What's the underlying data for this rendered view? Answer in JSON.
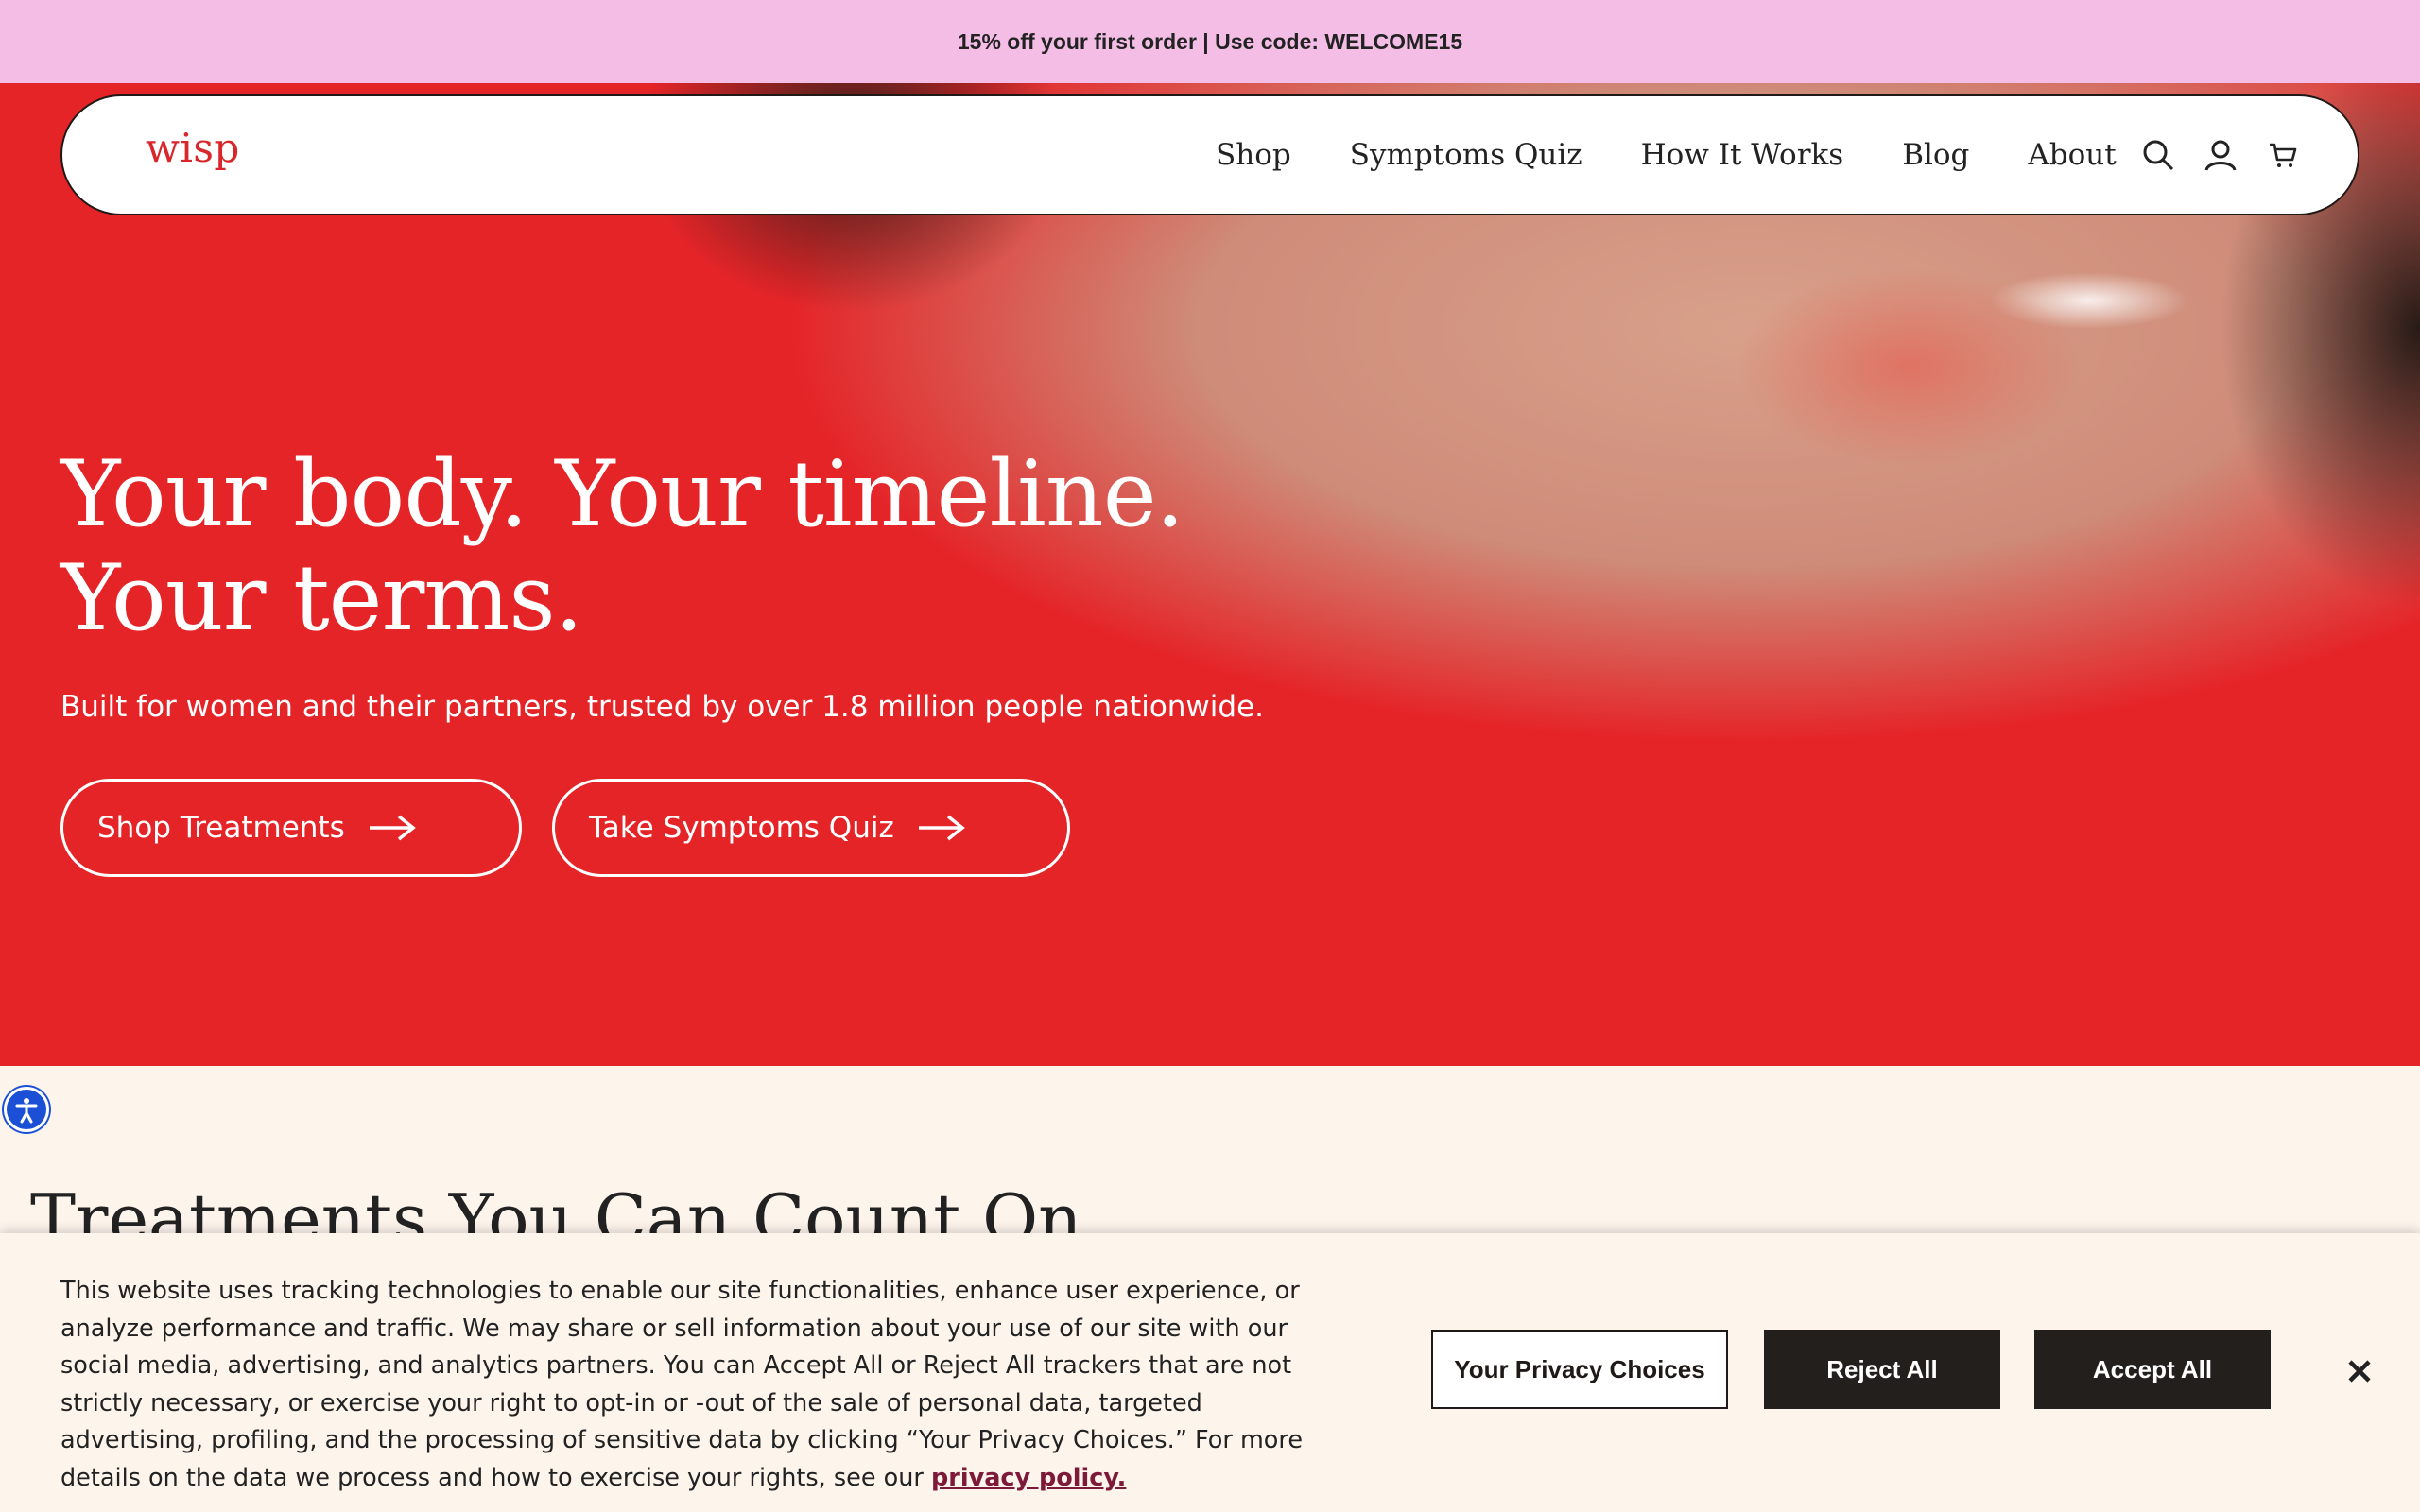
{
  "promo": {
    "text": "15% off your first order | Use code: WELCOME15"
  },
  "nav": {
    "logo": "wisp",
    "links": [
      "Shop",
      "Symptoms Quiz",
      "How It Works",
      "Blog",
      "About"
    ],
    "icons": [
      "search-icon",
      "account-icon",
      "cart-icon"
    ]
  },
  "hero": {
    "title_line1": "Your body. Your timeline.",
    "title_line2": "Your terms.",
    "subtitle": "Built for women and their partners, trusted by over 1.8 million people nationwide.",
    "primary_cta": "Shop Treatments",
    "secondary_cta": "Take Symptoms Quiz",
    "background_color": "#e52428"
  },
  "section": {
    "title": "Treatments You Can Count On"
  },
  "cookie": {
    "text": "This website uses tracking technologies to enable our site functionalities, enhance user experience, or analyze performance and traffic. We may share or sell information about your use of our site with our social media, advertising, and analytics partners. You can Accept All or Reject All trackers that are not strictly necessary, or exercise your right to opt-in or -out of the sale of personal data, targeted advertising, profiling, and the processing of sensitive data by clicking “Your Privacy Choices.” For more details on the data we process and how to exercise your rights, see our",
    "link": "privacy policy.",
    "choices_button": "Your Privacy Choices",
    "reject_button": "Reject All",
    "accept_button": "Accept All"
  },
  "accessibility": {
    "icon": "accessibility-icon"
  }
}
